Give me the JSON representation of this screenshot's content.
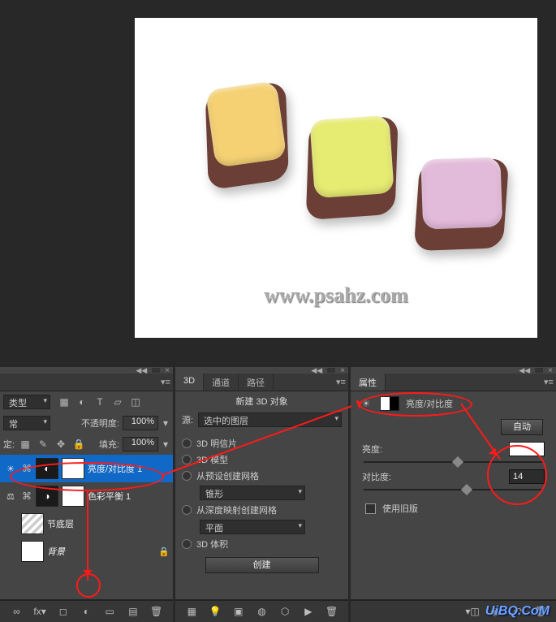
{
  "canvas": {
    "watermark": "www.psahz.com"
  },
  "layers_panel": {
    "tab_label": "类型",
    "type_label": "类型",
    "blend_label": "常",
    "opacity_label": "不透明度:",
    "opacity_value": "100%",
    "lock_label": "定:",
    "fill_label": "填充:",
    "fill_value": "100%",
    "icons": {
      "image": "image-icon",
      "adjust": "adjust-icon",
      "type": "type-icon",
      "shape": "shape-icon",
      "smart": "smart-icon"
    },
    "layers": [
      {
        "name": "亮度/对比度 1",
        "selected": true,
        "thumb": "bc",
        "eye": "sun"
      },
      {
        "name": "色彩平衡 1",
        "selected": false,
        "thumb": "cb",
        "eye": "scale"
      },
      {
        "name": "节底层",
        "selected": false,
        "thumb": "grad"
      },
      {
        "name": "背景",
        "selected": false,
        "thumb": "white",
        "locked": true
      }
    ],
    "bottom": {
      "link": "∞",
      "fx": "fx",
      "mask": "mask",
      "adjust": "adjust",
      "group": "group",
      "new": "new",
      "trash": "trash"
    }
  },
  "three_d_panel": {
    "tabs": [
      "3D",
      "通道",
      "路径"
    ],
    "section": "新建 3D 对象",
    "source_label": "源:",
    "source_value": "选中的图层",
    "opts": {
      "postcard": "3D 明信片",
      "model": "3D 模型",
      "preset": "从预设创建网格",
      "preset_value": "锥形",
      "depth": "从深度映射创建网格",
      "depth_value": "平面",
      "volume": "3D 体积"
    },
    "create": "创建"
  },
  "props_panel": {
    "tab": "属性",
    "title": "亮度/对比度",
    "auto": "自动",
    "brightness_label": "亮度:",
    "brightness_value": "",
    "contrast_label": "对比度:",
    "contrast_value": "14",
    "legacy": "使用旧版"
  },
  "footer": {
    "watermark": "UiBQ.CoM"
  }
}
